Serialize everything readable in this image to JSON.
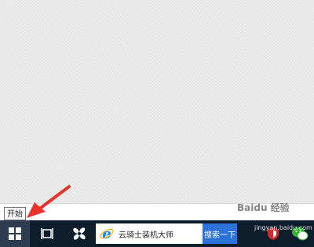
{
  "tooltip": {
    "start_label": "开始"
  },
  "taskbar": {
    "search_text": "云骑士装机大师",
    "search_button_label": "搜索一下"
  },
  "watermark": {
    "line1": "Baidu 经验",
    "line2": "jingyan.baidu.com"
  },
  "colors": {
    "taskbar_bg": "#0d1d2c",
    "start_button_bg": "#2d3d4f",
    "search_button_bg": "#2d72d9",
    "annotation_arrow": "#e8322b",
    "ie_blue": "#1a88e0",
    "wechat_green": "#2fb533"
  },
  "icons": [
    "windows-logo-icon",
    "task-view-icon",
    "fan-app-icon",
    "ie-icon",
    "antivirus-shield-icon",
    "wechat-icon"
  ]
}
